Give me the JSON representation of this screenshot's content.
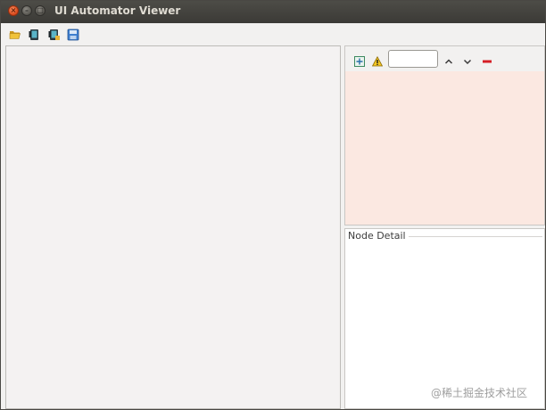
{
  "window": {
    "title": "UI Automator Viewer",
    "controls": {
      "close_glyph": "×",
      "minimize_glyph": "–",
      "maximize_glyph": "□"
    }
  },
  "toolbar": {
    "buttons": [
      {
        "name": "open-icon"
      },
      {
        "name": "device-screenshot-icon"
      },
      {
        "name": "device-screenshot-compressed-icon"
      },
      {
        "name": "save-icon"
      }
    ]
  },
  "tree_panel": {
    "buttons": [
      {
        "name": "expand-all-icon"
      },
      {
        "name": "warning-icon"
      },
      {
        "name": "previous-icon"
      },
      {
        "name": "next-icon"
      },
      {
        "name": "clear-icon"
      }
    ],
    "search": {
      "value": "",
      "placeholder": ""
    }
  },
  "node_detail": {
    "title": "Node Detail"
  },
  "watermark": {
    "text": "@稀土掘金技术社区"
  },
  "colors": {
    "titlebar": "#3f3e3a",
    "window_bg": "#f2f1f0",
    "tree_bg": "#fbe8e1",
    "close_button": "#e05a2b"
  }
}
